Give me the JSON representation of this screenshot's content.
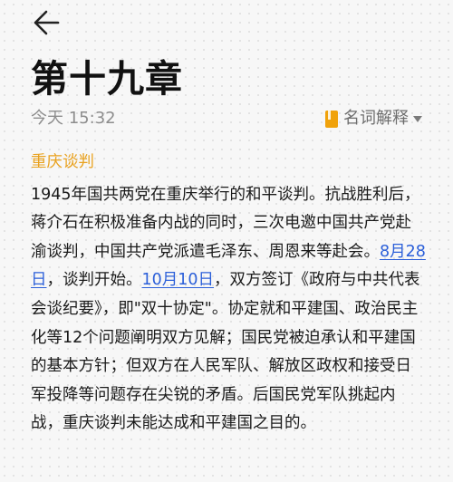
{
  "header": {
    "back_icon": "arrow-left-icon"
  },
  "note": {
    "title": "第十九章",
    "timestamp": "今天 15:32",
    "folder": {
      "label": "名词解释",
      "icon": "bookmark-folder-icon",
      "icon_color": "#f0a20b",
      "dropdown_icon": "caret-down-icon"
    },
    "section_heading": "重庆谈判",
    "heading_color": "#e9a21f",
    "link_color": "#2b5fd9",
    "body": {
      "part1": "1945年国共两党在重庆举行的和平谈判。抗战胜利后，蒋介石在积极准备内战的同时，三次电邀中国共产党赴渝谈判，中国共产党派遣毛泽东、周恩来等赴会。",
      "link1": "8月28日",
      "part2": "，谈判开始。",
      "link2": "10月10日",
      "part3": "，双方签订《政府与中共代表会谈纪要》，即\"双十协定\"。协定就和平建国、政治民主化等12个问题阐明双方见解；国民党被迫承认和平建国的基本方针；但双方在人民军队、解放区政权和接受日军投降等问题存在尖锐的矛盾。后国民党军队挑起内战，重庆谈判未能达成和平建国之目的。"
    }
  }
}
